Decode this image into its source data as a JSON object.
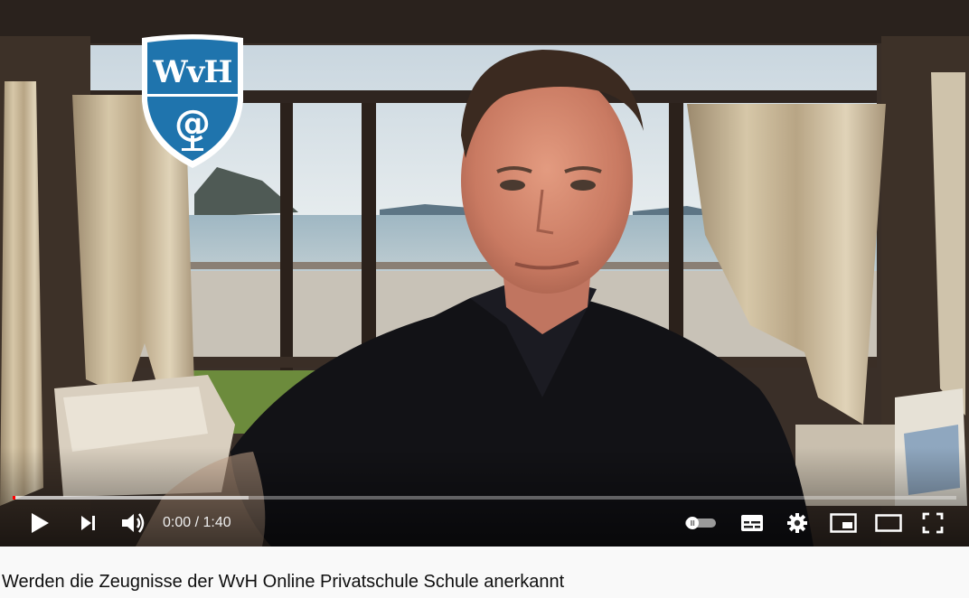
{
  "video": {
    "logo_text": "WvH",
    "current_time": "0:00",
    "separator": " / ",
    "duration": "1:40",
    "progress_played": 0.003,
    "progress_buffered": 0.25,
    "autoplay_on": false
  },
  "controls": {
    "play_icon": "play-icon",
    "next_icon": "next-icon",
    "volume_icon": "volume-icon",
    "autoplay_icon": "autoplay-toggle-icon",
    "subtitles_icon": "subtitles-icon",
    "settings_icon": "gear-icon",
    "miniplayer_icon": "miniplayer-icon",
    "theater_icon": "theater-mode-icon",
    "fullscreen_icon": "fullscreen-icon"
  },
  "title": "Werden die Zeugnisse der WvH Online Privatschule Schule anerkannt",
  "colors": {
    "progress_red": "#ff0000",
    "shield_blue": "#1f74ad",
    "shirt_black": "#121216"
  }
}
